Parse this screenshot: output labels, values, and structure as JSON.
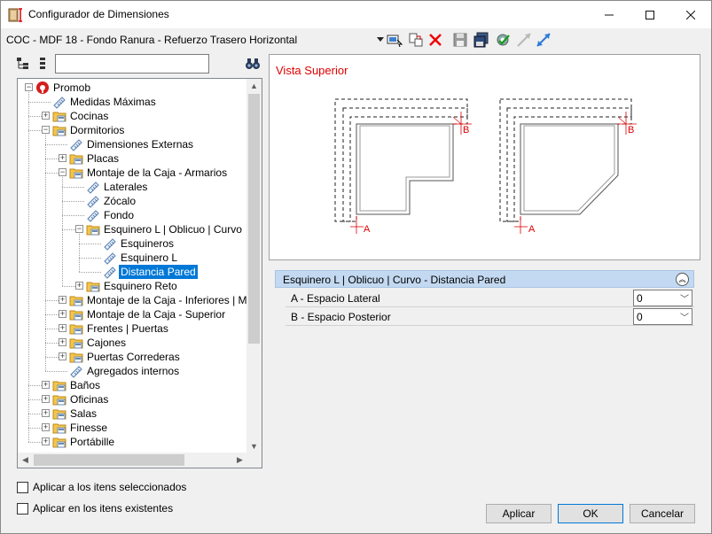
{
  "window": {
    "title": "Configurador de Dimensiones"
  },
  "toolbar": {
    "path": "COC - MDF 18 - Fondo Ranura - Refuerzo Trasero Horizontal",
    "dropdown_icon": "caret-down-icon"
  },
  "tree": {
    "search_value": "",
    "nodes": [
      {
        "label": "Promob",
        "level": 0,
        "expander": "-",
        "icon": "promob-logo"
      },
      {
        "label": "Medidas Máximas",
        "level": 1,
        "expander": "",
        "icon": "tag"
      },
      {
        "label": "Cocinas",
        "level": 1,
        "expander": "+",
        "icon": "folder"
      },
      {
        "label": "Dormitorios",
        "level": 1,
        "expander": "-",
        "icon": "folder"
      },
      {
        "label": "Dimensiones Externas",
        "level": 2,
        "expander": "",
        "icon": "tag"
      },
      {
        "label": "Placas",
        "level": 2,
        "expander": "+",
        "icon": "folder"
      },
      {
        "label": "Montaje de la Caja - Armarios",
        "level": 2,
        "expander": "-",
        "icon": "folder"
      },
      {
        "label": "Laterales",
        "level": 3,
        "expander": "",
        "icon": "tag"
      },
      {
        "label": "Zócalo",
        "level": 3,
        "expander": "",
        "icon": "tag"
      },
      {
        "label": "Fondo",
        "level": 3,
        "expander": "",
        "icon": "tag"
      },
      {
        "label": "Esquinero L | Oblicuo | Curvo",
        "level": 3,
        "expander": "-",
        "icon": "folder"
      },
      {
        "label": "Esquineros",
        "level": 4,
        "expander": "",
        "icon": "tag"
      },
      {
        "label": "Esquinero L",
        "level": 4,
        "expander": "",
        "icon": "tag"
      },
      {
        "label": "Distancia Pared",
        "level": 4,
        "expander": "",
        "icon": "tag",
        "selected": true
      },
      {
        "label": "Esquinero Reto",
        "level": 3,
        "expander": "+",
        "icon": "folder"
      },
      {
        "label": "Montaje de la Caja - Inferiores | Mesa",
        "level": 2,
        "expander": "+",
        "icon": "folder"
      },
      {
        "label": "Montaje de la Caja - Superior",
        "level": 2,
        "expander": "+",
        "icon": "folder"
      },
      {
        "label": "Frentes | Puertas",
        "level": 2,
        "expander": "+",
        "icon": "folder"
      },
      {
        "label": "Cajones",
        "level": 2,
        "expander": "+",
        "icon": "folder"
      },
      {
        "label": "Puertas Correderas",
        "level": 2,
        "expander": "+",
        "icon": "folder"
      },
      {
        "label": "Agregados internos",
        "level": 2,
        "expander": "",
        "icon": "tag"
      },
      {
        "label": "Baños",
        "level": 1,
        "expander": "+",
        "icon": "folder"
      },
      {
        "label": "Oficinas",
        "level": 1,
        "expander": "+",
        "icon": "folder"
      },
      {
        "label": "Salas",
        "level": 1,
        "expander": "+",
        "icon": "folder"
      },
      {
        "label": "Finesse",
        "level": 1,
        "expander": "+",
        "icon": "folder"
      },
      {
        "label": "Portábille",
        "level": 1,
        "expander": "+",
        "icon": "folder"
      }
    ]
  },
  "preview": {
    "title": "Vista Superior",
    "label_a": "A",
    "label_b": "B",
    "accent_color": "#e00000"
  },
  "grid": {
    "header": "Esquinero L | Oblicuo | Curvo - Distancia Pared",
    "rows": [
      {
        "label": "A - Espacio Lateral",
        "value": "0"
      },
      {
        "label": "B - Espacio Posterior",
        "value": "0"
      }
    ]
  },
  "options": {
    "apply_selected": "Aplicar a los itens seleccionados",
    "apply_existing": "Aplicar en los itens existentes"
  },
  "buttons": {
    "apply": "Aplicar",
    "ok": "OK",
    "cancel": "Cancelar"
  }
}
